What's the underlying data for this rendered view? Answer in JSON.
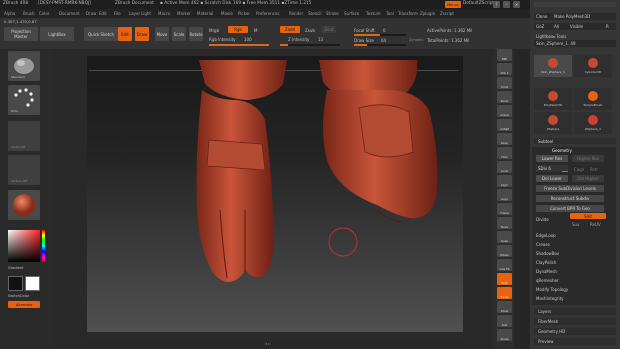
{
  "title": {
    "app": "ZBrush 4R8",
    "build": "[DESY-PMRT-RMRK-NBQJ]",
    "product": "ZBrush Document",
    "info": "▪ Active Mem 462 ▪ Scratch Disk 169 ▪ Free Mem 3511 ▪ZTime 1.215",
    "menus_btn": "Menus",
    "script": "DefaultZScript"
  },
  "menubar": [
    "Alpha",
    "Brush",
    "Color",
    "Document",
    "Draw",
    "Edit",
    "File",
    "Layer",
    "Light",
    "Macro",
    "Marker",
    "Material",
    "Movie",
    "Picker",
    "Preferences",
    "Render",
    "Stencil",
    "Stroke",
    "Surface",
    "Texture",
    "Tool",
    "Transform",
    "Zplugin",
    "Zscript"
  ],
  "coords": "0.307,1.470,0.67",
  "toolbar": {
    "projection_master": "Projection Master",
    "lightbox": "LightBox",
    "quick_sketch": "Quick Sketch",
    "edit": "Edit",
    "draw": "Draw",
    "move": "Move",
    "scale": "Scale",
    "rotate": "Rotate",
    "mrgb": "Mrgb",
    "rgb": "Rgb",
    "m": "M",
    "rgb_intensity_label": "Rgb Intensity",
    "rgb_intensity_value": "100",
    "rgb_intensity": 1.0,
    "zadd": "Zadd",
    "zsub": "Zsub",
    "zcut": "Zcut",
    "z_intensity_label": "Z Intensity",
    "z_intensity_value": "13",
    "z_intensity": 0.13,
    "focal_shift_label": "Focal Shift",
    "focal_shift_value": "0",
    "focal_shift": 0.5,
    "draw_size_label": "Draw Size",
    "draw_size_value": "64",
    "draw_size": 0.25,
    "dynamic": "Dynamic",
    "active_points": "ActivePoints: 1.362 Mil",
    "total_points": "TotalPoints: 1.362 Mil"
  },
  "leftshelf": {
    "brush_label": "Standard",
    "stroke_label": "Dots",
    "alpha_label": "Alpha Off",
    "texture_label": "Texture Off",
    "material_label": "MatCap Red",
    "gradient": "Gradient",
    "switch_color": "SwitchColor",
    "alternate": "Alternate"
  },
  "rightshelf": [
    "BPR",
    "SPix 3",
    "Scroll",
    "Zoom",
    "Actual",
    "AAHalf",
    "Persp",
    "Floor",
    "Local",
    "LSym",
    "Gxyz",
    "Frame",
    "Move",
    "Scale",
    "Rotate",
    "Line Fill",
    "PolyF",
    "Transp",
    "Ghost",
    "Solo",
    "Xpose"
  ],
  "tray": {
    "header1": [
      "Clone",
      "Make PolyMesh3D"
    ],
    "header2": [
      "GoZ",
      "All",
      "Visible",
      "R"
    ],
    "lightbox_tools": "Lightbox▸ Tools",
    "current_tool": "Skin_ZSphere_1. 49",
    "tools": [
      "Skin_ZSphere_1",
      "Cylinder3D",
      "PolyMesh3D",
      "SimpleBrush",
      "ZSphere",
      "ZSphere_1"
    ],
    "subtool": "Subtool",
    "geometry": "Geometry",
    "lower_res": "Lower Res",
    "higher_res": "Higher Res",
    "sdiv": "SDiv 6",
    "cage": "Cage",
    "rstr": "Rstr",
    "del_lower": "Del Lower",
    "del_higher": "Del Higher",
    "freeze_subdiv": "Freeze SubDivision Levels",
    "reconstruct": "Reconstruct Subdiv",
    "convert_bpr": "Convert BPR To Geo",
    "divide": "Divide",
    "smt": "Smt",
    "suv": "Suv",
    "reuv": "ReUV",
    "items": [
      "EdgeLoop",
      "Crease",
      "ShadowBox",
      "ClayPolish",
      "DynaMesh",
      "qRemesher",
      "Modify Topology",
      "MeshIntegrity"
    ],
    "layers": "Layers",
    "fibermesh": "FiberMesh",
    "geometry_hd": "Geometry HD",
    "preview": "Preview"
  },
  "colors": {
    "accent": "#e8620f",
    "model": "#c44b30",
    "panel": "#353535"
  }
}
